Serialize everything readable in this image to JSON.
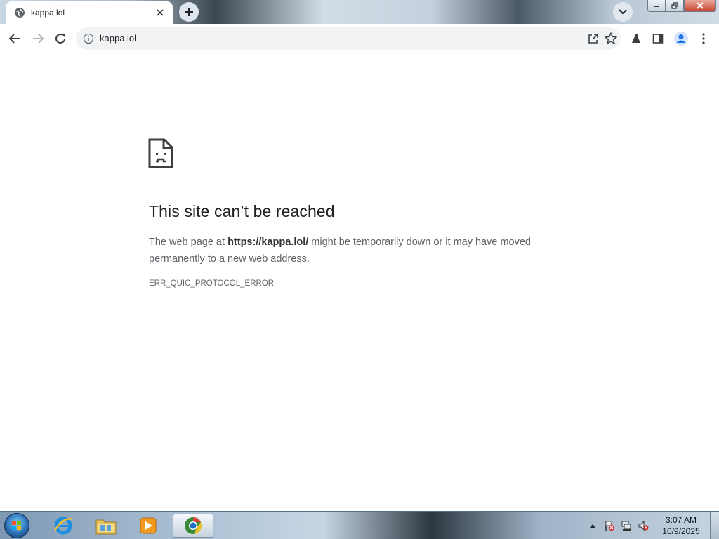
{
  "browser": {
    "tab": {
      "title": "kappa.lol",
      "favicon_icon": "globe-icon",
      "close_icon": "close-icon"
    },
    "newtab_icon": "plus-icon",
    "tabsearch_icon": "chevron-down-icon",
    "window_controls": [
      "minimize-icon",
      "restore-icon",
      "close-icon"
    ],
    "toolbar": {
      "back_icon": "back-arrow-icon",
      "forward_icon": "forward-arrow-icon",
      "reload_icon": "reload-icon",
      "address": {
        "site_info_icon": "info-icon",
        "url": "kappa.lol"
      },
      "share_icon": "share-icon",
      "bookmark_icon": "star-icon",
      "labs_icon": "flask-icon",
      "side_panel_icon": "side-panel-icon",
      "profile_icon": "profile-icon",
      "menu_icon": "kebab-menu-icon"
    }
  },
  "error_page": {
    "icon": "sad-page-icon",
    "title": "This site can’t be reached",
    "desc_prefix": "The web page at ",
    "desc_url": "https://kappa.lol/",
    "desc_suffix": " might be temporarily down or it may have moved permanently to a new web address.",
    "error_code": "ERR_QUIC_PROTOCOL_ERROR"
  },
  "taskbar": {
    "start_icon": "windows-start-icon",
    "pinned": [
      {
        "name": "internet-explorer-icon"
      },
      {
        "name": "file-explorer-icon"
      },
      {
        "name": "media-player-icon"
      },
      {
        "name": "chrome-icon",
        "active": true
      }
    ],
    "tray": {
      "icons": [
        "show-hidden-icons-icon",
        "action-center-flag-icon",
        "network-icon",
        "volume-muted-icon"
      ],
      "time": "3:07 AM",
      "date": "10/9/2025"
    }
  }
}
